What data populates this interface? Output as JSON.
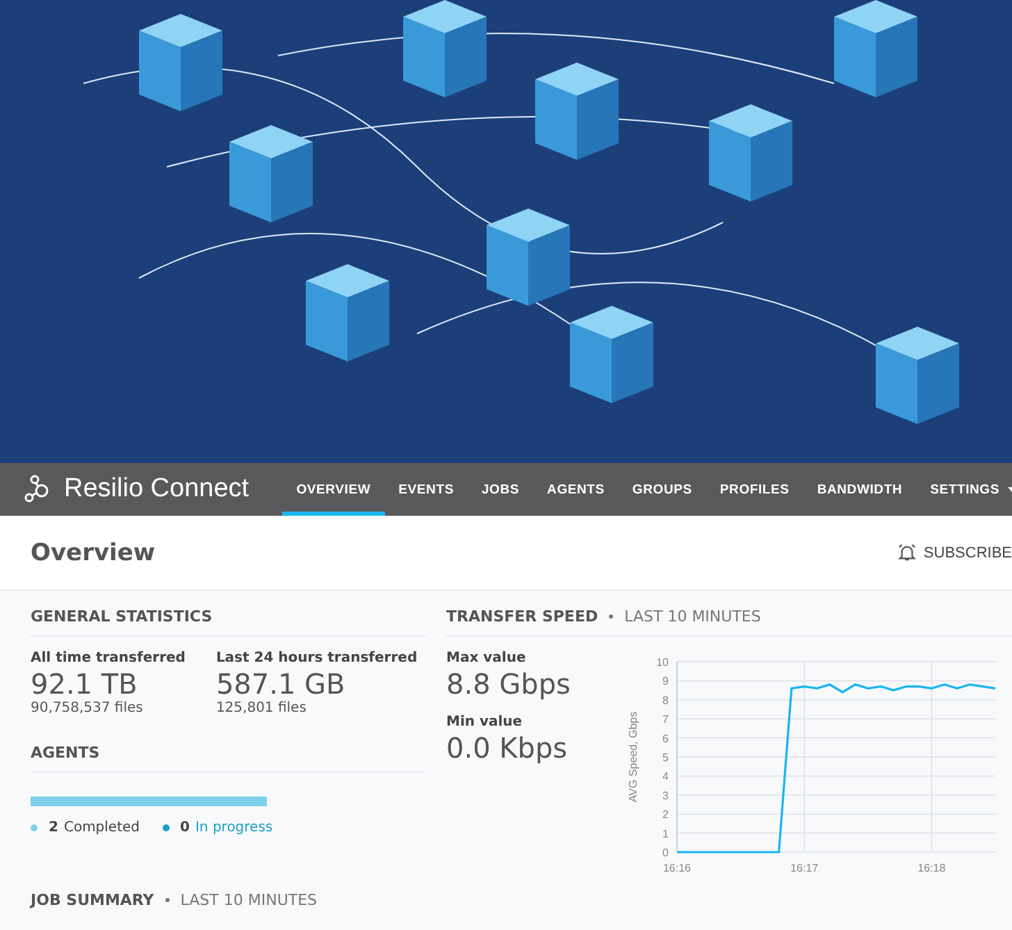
{
  "brand": {
    "name_bold": "Resilio",
    "name_light": "Connect"
  },
  "nav": [
    {
      "label": "OVERVIEW",
      "selected": true
    },
    {
      "label": "EVENTS",
      "selected": false
    },
    {
      "label": "JOBS",
      "selected": false
    },
    {
      "label": "AGENTS",
      "selected": false
    },
    {
      "label": "GROUPS",
      "selected": false
    },
    {
      "label": "PROFILES",
      "selected": false
    },
    {
      "label": "BANDWIDTH",
      "selected": false
    },
    {
      "label": "SETTINGS",
      "selected": false,
      "dropdown": true
    }
  ],
  "page": {
    "title": "Overview",
    "subscribe": "SUBSCRIBE"
  },
  "general_statistics": {
    "title": "GENERAL STATISTICS",
    "stats": [
      {
        "label": "All time transferred",
        "value": "92.1 TB",
        "files": "90,758,537 files"
      },
      {
        "label": "Last 24 hours transferred",
        "value": "587.1 GB",
        "files": "125,801 files"
      }
    ]
  },
  "agents": {
    "title": "AGENTS",
    "level": 1,
    "legend": [
      {
        "count": "2",
        "label": "Completed",
        "color": "#7fd0ea",
        "link": false
      },
      {
        "count": "0",
        "label": "In progress",
        "color": "#1a9fc7",
        "link": true
      }
    ]
  },
  "transfer_speed": {
    "title": "TRANSFER SPEED",
    "period": "LAST 10 MINUTES",
    "stats": [
      {
        "label": "Max value",
        "value": "8.8 Gbps"
      },
      {
        "label": "Min value",
        "value": "0.0 Kbps"
      }
    ],
    "chart_data": {
      "type": "line",
      "ylabel": "AVG Speed, Gbps",
      "ylim": [
        0,
        10
      ],
      "grid": true,
      "yticks": [
        0,
        1,
        2,
        3,
        4,
        5,
        6,
        7,
        8,
        9,
        10
      ],
      "categories": [
        "16:16",
        null,
        null,
        null,
        null,
        null,
        null,
        null,
        null,
        null,
        "16:17",
        null,
        null,
        null,
        null,
        null,
        null,
        null,
        null,
        null,
        "16:18",
        null,
        null,
        null,
        null,
        null
      ],
      "series": [
        {
          "color": "#19b5f0",
          "values": [
            0,
            0,
            0,
            0,
            0,
            0,
            0,
            0,
            0,
            8.6,
            8.7,
            8.6,
            8.8,
            8.4,
            8.8,
            8.6,
            8.7,
            8.5,
            8.7,
            8.7,
            8.6,
            8.8,
            8.6,
            8.8,
            8.7,
            8.6
          ]
        }
      ]
    }
  },
  "job_summary": {
    "title": "JOB SUMMARY",
    "period": "LAST 10 MINUTES"
  }
}
